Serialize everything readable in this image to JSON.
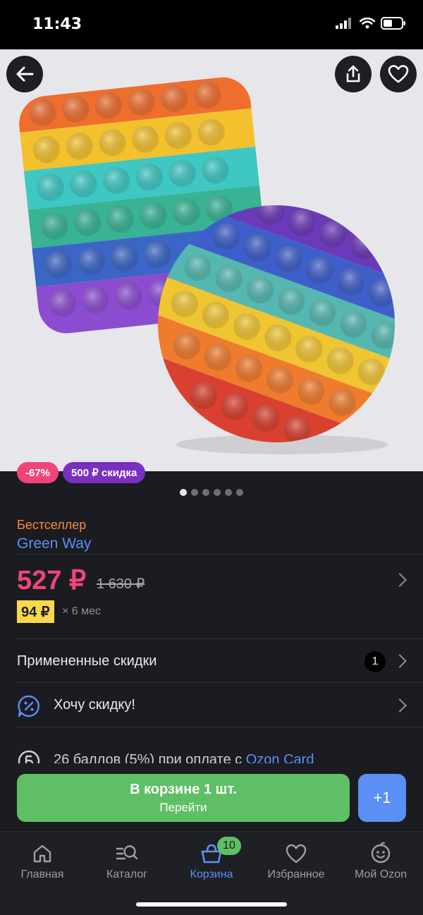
{
  "status": {
    "time": "11:43"
  },
  "product": {
    "badges": [
      "-67%",
      "500 ₽ скидка"
    ],
    "tag": "Бестселлер",
    "brand": "Green Way",
    "price": "527 ₽",
    "old_price": "1 630 ₽",
    "installment_amount": "94 ₽",
    "installment_term": "× 6 мес",
    "gallery_count": 6,
    "gallery_active_index": 0
  },
  "rows": {
    "discounts_label": "Примененные скидки",
    "discounts_count": "1",
    "want_discount_label": "Хочу скидку!",
    "bonus_text": "26 баллов (5%) при оплате с ",
    "bonus_link": "Ozon Card"
  },
  "cta": {
    "cart_title": "В корзине 1 шт.",
    "cart_subtitle": "Перейти",
    "plus_label": "+1"
  },
  "tabbar": {
    "items": [
      {
        "label": "Главная",
        "icon": "home-icon"
      },
      {
        "label": "Каталог",
        "icon": "catalog-search-icon"
      },
      {
        "label": "Корзина",
        "icon": "basket-icon"
      },
      {
        "label": "Избранное",
        "icon": "heart-icon"
      },
      {
        "label": "Мой Ozon",
        "icon": "smiley-icon"
      }
    ],
    "cart_badge": "10",
    "active_index": 2
  },
  "colors": {
    "accent_price": "#f0457a",
    "link": "#5d8ef7",
    "cart_green": "#5fbf66",
    "installment_yellow": "#f9d94a"
  }
}
